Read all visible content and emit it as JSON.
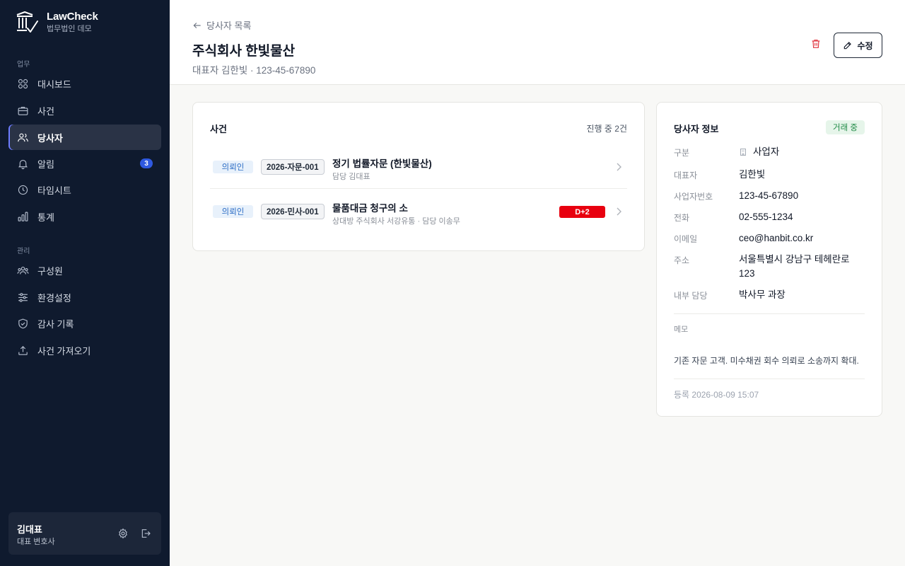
{
  "sidebar": {
    "brand": {
      "name": "LawCheck",
      "sub": "법무법인 데모"
    },
    "section_work": "업무",
    "section_admin": "관리",
    "items": [
      {
        "label": "대시보드",
        "icon": "grid-icon"
      },
      {
        "label": "사건",
        "icon": "briefcase-icon"
      },
      {
        "label": "당사자",
        "icon": "users-icon",
        "active": true
      },
      {
        "label": "알림",
        "icon": "bell-icon",
        "badge": "3"
      },
      {
        "label": "타임시트",
        "icon": "clock-icon"
      },
      {
        "label": "통계",
        "icon": "bar-chart-icon"
      },
      {
        "label": "구성원",
        "icon": "team-icon"
      },
      {
        "label": "환경설정",
        "icon": "sliders-icon"
      },
      {
        "label": "감사 기록",
        "icon": "shield-icon"
      },
      {
        "label": "사건 가져오기",
        "icon": "upload-icon"
      }
    ],
    "user": {
      "name": "김대표",
      "role": "대표 변호사"
    }
  },
  "header": {
    "back": "당사자 목록",
    "title": "주식회사 한빛물산",
    "subtitle": "대표자 김한빛 · 123-45-67890",
    "edit_label": "수정"
  },
  "cases": {
    "title": "사건",
    "meta": "진행 중 2건",
    "rows": [
      {
        "role": "의뢰인",
        "code": "2026-자문-001",
        "title": "정기 법률자문 (한빛물산)",
        "sub": "담당 김대표",
        "dday": ""
      },
      {
        "role": "의뢰인",
        "code": "2026-민사-001",
        "title": "물품대금 청구의 소",
        "sub": "상대방 주식회사 서강유통 · 담당 이송무",
        "dday": "D+2"
      }
    ]
  },
  "party": {
    "title": "당사자 정보",
    "status": "거래 중",
    "fields": [
      {
        "label": "구분",
        "value": "사업자"
      },
      {
        "label": "대표자",
        "value": "김한빛"
      },
      {
        "label": "사업자번호",
        "value": "123-45-67890"
      },
      {
        "label": "전화",
        "value": "02-555-1234"
      },
      {
        "label": "이메일",
        "value": "ceo@hanbit.co.kr"
      },
      {
        "label": "주소",
        "value": "서울특별시 강남구 테헤란로 123"
      },
      {
        "label": "내부 담당",
        "value": "박사무 과장"
      }
    ],
    "memo_label": "메모",
    "memo": "기존 자문 고객. 미수채권 회수 의뢰로 소송까지 확대.",
    "registered": "등록 2026-08-09 15:07"
  },
  "colors": {
    "sidebar_bg": "#0f1a2e",
    "accent": "#2f59e0",
    "danger": "#e8000f",
    "success": "#1f8a45"
  }
}
